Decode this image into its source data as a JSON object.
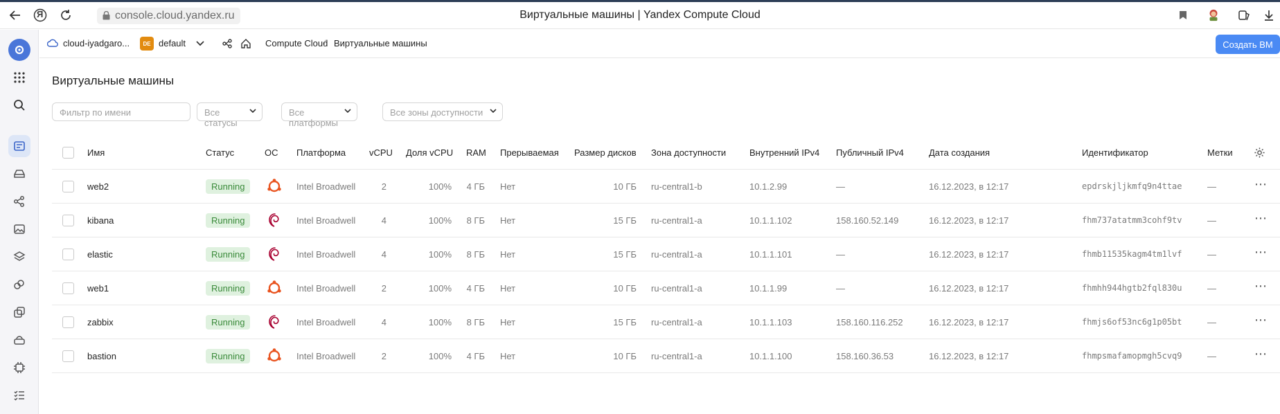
{
  "browser": {
    "url": "console.cloud.yandex.ru",
    "title": "Виртуальные машины | Yandex Compute Cloud",
    "browser_logo": "Я"
  },
  "header": {
    "cloud": "cloud-iyadgaro...",
    "folder_badge": "DE",
    "folder": "default",
    "breadcrumb_service": "Compute Cloud",
    "breadcrumb_sep": "/",
    "breadcrumb_page": "Виртуальные машины",
    "create_button": "Создать ВМ"
  },
  "page": {
    "heading": "Виртуальные машины",
    "filter_placeholder": "Фильтр по имени",
    "status_select": "Все статусы",
    "platform_select": "Все платформы",
    "zone_select": "Все зоны доступности"
  },
  "table": {
    "columns": {
      "name": "Имя",
      "status": "Статус",
      "os": "ОС",
      "platform": "Платформа",
      "vcpu": "vCPU",
      "vcpu_share": "Доля vCPU",
      "ram": "RAM",
      "preemptible": "Прерываемая",
      "disk": "Размер дисков",
      "zone": "Зона доступности",
      "internal_ip": "Внутренний IPv4",
      "public_ip": "Публичный IPv4",
      "created": "Дата создания",
      "id": "Идентификатор",
      "labels": "Метки"
    },
    "rows": [
      {
        "name": "web2",
        "status": "Running",
        "os": "ubuntu",
        "platform": "Intel Broadwell",
        "vcpu": "2",
        "vcpu_share": "100%",
        "ram": "4 ГБ",
        "preemptible": "Нет",
        "disk": "10 ГБ",
        "zone": "ru-central1-b",
        "internal_ip": "10.1.2.99",
        "public_ip": "—",
        "created": "16.12.2023, в 12:17",
        "id": "epdrskjljkmfq9n4ttae",
        "labels": "—"
      },
      {
        "name": "kibana",
        "status": "Running",
        "os": "debian",
        "platform": "Intel Broadwell",
        "vcpu": "4",
        "vcpu_share": "100%",
        "ram": "8 ГБ",
        "preemptible": "Нет",
        "disk": "15 ГБ",
        "zone": "ru-central1-a",
        "internal_ip": "10.1.1.102",
        "public_ip": "158.160.52.149",
        "created": "16.12.2023, в 12:17",
        "id": "fhm737atatmm3cohf9tv",
        "labels": "—"
      },
      {
        "name": "elastic",
        "status": "Running",
        "os": "debian",
        "platform": "Intel Broadwell",
        "vcpu": "4",
        "vcpu_share": "100%",
        "ram": "8 ГБ",
        "preemptible": "Нет",
        "disk": "15 ГБ",
        "zone": "ru-central1-a",
        "internal_ip": "10.1.1.101",
        "public_ip": "—",
        "created": "16.12.2023, в 12:17",
        "id": "fhmb11535kagm4tm1lvf",
        "labels": "—"
      },
      {
        "name": "web1",
        "status": "Running",
        "os": "ubuntu",
        "platform": "Intel Broadwell",
        "vcpu": "2",
        "vcpu_share": "100%",
        "ram": "4 ГБ",
        "preemptible": "Нет",
        "disk": "10 ГБ",
        "zone": "ru-central1-a",
        "internal_ip": "10.1.1.99",
        "public_ip": "—",
        "created": "16.12.2023, в 12:17",
        "id": "fhmhh944hgtb2fql830u",
        "labels": "—"
      },
      {
        "name": "zabbix",
        "status": "Running",
        "os": "debian",
        "platform": "Intel Broadwell",
        "vcpu": "4",
        "vcpu_share": "100%",
        "ram": "8 ГБ",
        "preemptible": "Нет",
        "disk": "15 ГБ",
        "zone": "ru-central1-a",
        "internal_ip": "10.1.1.103",
        "public_ip": "158.160.116.252",
        "created": "16.12.2023, в 12:17",
        "id": "fhmjs6of53nc6g1p05bt",
        "labels": "—"
      },
      {
        "name": "bastion",
        "status": "Running",
        "os": "ubuntu",
        "platform": "Intel Broadwell",
        "vcpu": "2",
        "vcpu_share": "100%",
        "ram": "4 ГБ",
        "preemptible": "Нет",
        "disk": "10 ГБ",
        "zone": "ru-central1-a",
        "internal_ip": "10.1.1.100",
        "public_ip": "158.160.36.53",
        "created": "16.12.2023, в 12:17",
        "id": "fhmpsmafamopmgh5cvq9",
        "labels": "—"
      }
    ]
  },
  "colors": {
    "accent": "#4a8af4",
    "status_running_bg": "#dff1df",
    "status_running_text": "#3a8a3a",
    "ubuntu": "#e95420",
    "debian": "#a80030"
  },
  "icons": {
    "nav": [
      "logo-icon",
      "apps-grid-icon",
      "search-icon",
      "compute-icon",
      "disk-icon",
      "network-icon",
      "image-icon",
      "layers-icon",
      "instance-groups-icon",
      "snapshot-icon",
      "cloud-icon",
      "chip-icon",
      "list-icon"
    ]
  }
}
